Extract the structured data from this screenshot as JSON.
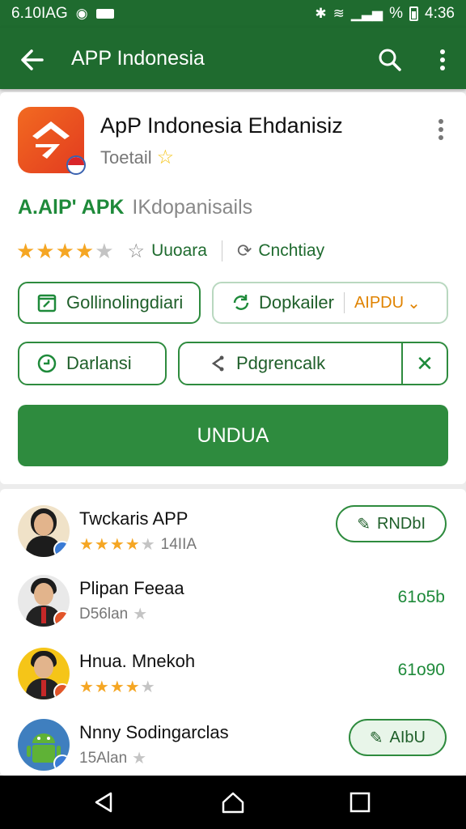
{
  "status_bar": {
    "time_left": "6.10IAG",
    "time_right": "4:36",
    "percent": "%"
  },
  "app_bar": {
    "title": "APP Indonesia"
  },
  "app_card": {
    "name": "ApP Indonesia Ehdanisiz",
    "subtitle": "Toetail",
    "apk_label": "A.AlP' APK",
    "apk_desc": "IKdopanisails",
    "rating_label_1": "Uuoara",
    "rating_label_2": "Cnchtiay",
    "rating_value": 3.5,
    "buttons": {
      "gallery": "Gollinolingdiari",
      "download": "Dopkailer",
      "download_accent": "AIPDU",
      "darlansi": "Darlansi",
      "pdg": "Pdgrencalk",
      "main": "UNDUA"
    }
  },
  "list": [
    {
      "name": "Twckaris APP",
      "meta": "14IIA",
      "rating": 4.5,
      "action": "RNDbI",
      "action_type": "pill",
      "avatar": "woman"
    },
    {
      "name": "Plipan Feeaa",
      "meta": "D56lan",
      "action": "61o5b",
      "action_type": "text",
      "avatar": "man-suit"
    },
    {
      "name": "Hnua. Mnekoh",
      "meta": "",
      "rating": 4.5,
      "action": "61o90",
      "action_type": "text",
      "avatar": "man-yellow"
    },
    {
      "name": "Nnny Sodingarclas",
      "meta": "15Alan",
      "action": "AIbU",
      "action_type": "pill-light",
      "avatar": "android"
    }
  ],
  "colors": {
    "primary": "#1f6b2f",
    "accent_green": "#2e8b3e",
    "star": "#f5a623",
    "orange_icon": "#f26a21"
  },
  "icons": {
    "back": "arrow-left-icon",
    "search": "search-icon",
    "more": "more-vert-icon"
  }
}
